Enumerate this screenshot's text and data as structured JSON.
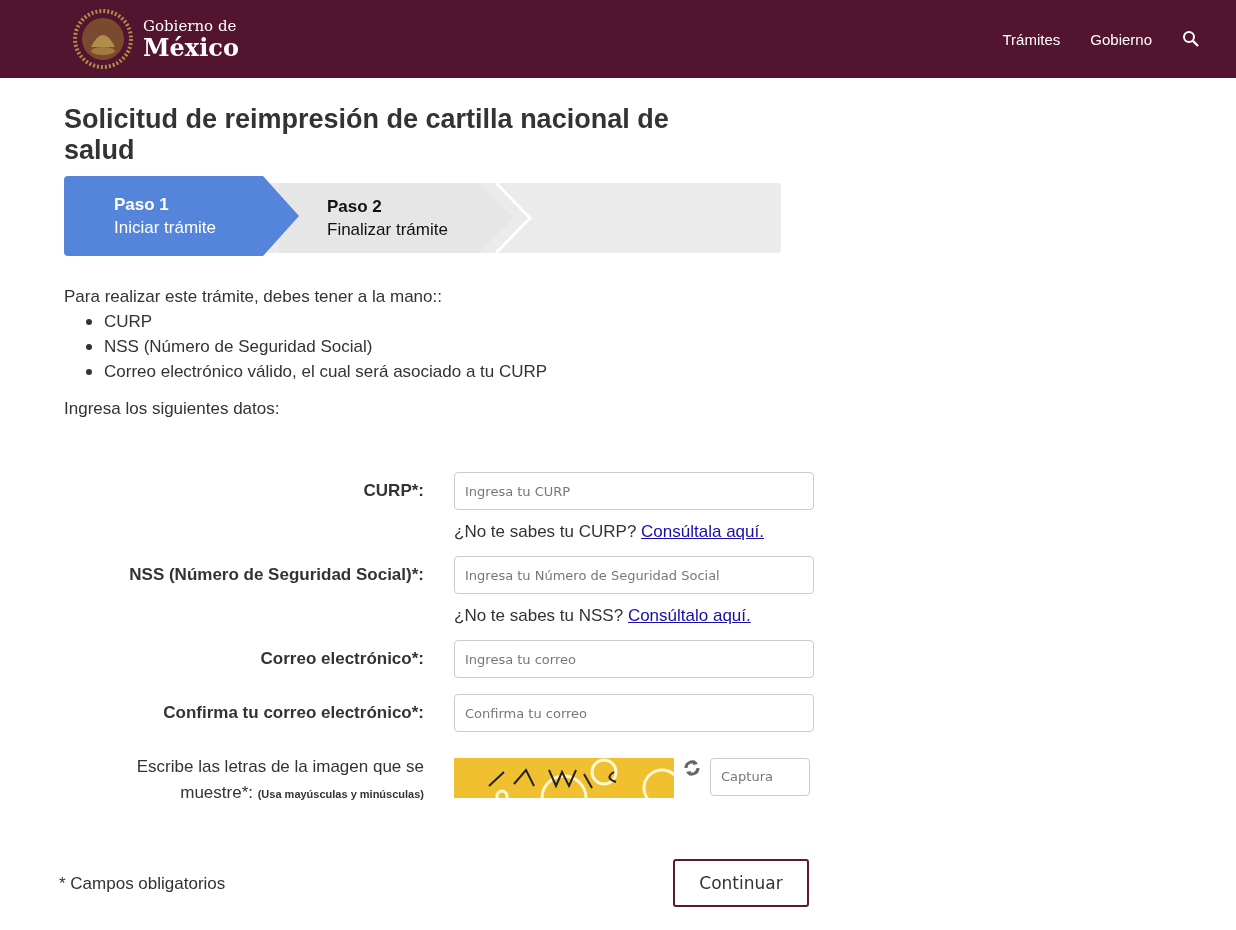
{
  "header": {
    "brand_line1": "Gobierno de",
    "brand_line2": "México",
    "nav": [
      {
        "label": "Trámites"
      },
      {
        "label": "Gobierno"
      }
    ]
  },
  "title": "Solicitud de reimpresión de cartilla nacional de salud",
  "steps": [
    {
      "title": "Paso 1",
      "subtitle": "Iniciar trámite",
      "selected": true
    },
    {
      "title": "Paso 2",
      "subtitle": "Finalizar trámite",
      "selected": false
    }
  ],
  "intro": "Para realizar este trámite, debes tener a la mano::",
  "requirements": [
    "CURP",
    "NSS (Número de Seguridad Social)",
    "Correo electrónico válido, el cual será asociado a tu CURP"
  ],
  "instruction": "Ingresa los siguientes datos:",
  "fields": [
    {
      "label": "CURP*:",
      "placeholder": "Ingresa tu CURP",
      "help": {
        "text": "¿No te sabes tu CURP?",
        "link": "Consúltala aquí."
      }
    },
    {
      "label": "NSS (Número de Seguridad Social)*:",
      "placeholder": "Ingresa tu Número de Seguridad Social",
      "help": {
        "text": "¿No te sabes tu NSS?",
        "link": "Consúltalo aquí."
      }
    },
    {
      "label": "Correo electrónico*:",
      "placeholder": "Ingresa tu correo"
    },
    {
      "label": "Confirma tu correo electrónico*:",
      "placeholder": "Confirma tu correo"
    }
  ],
  "captcha": {
    "label": "Escribe las letras de la imagen que se muestre*:",
    "note": "(Usa mayúsculas y minúsculas)",
    "placeholder": "Captura"
  },
  "required_note": "* Campos obligatorios",
  "submit": "Continuar"
}
